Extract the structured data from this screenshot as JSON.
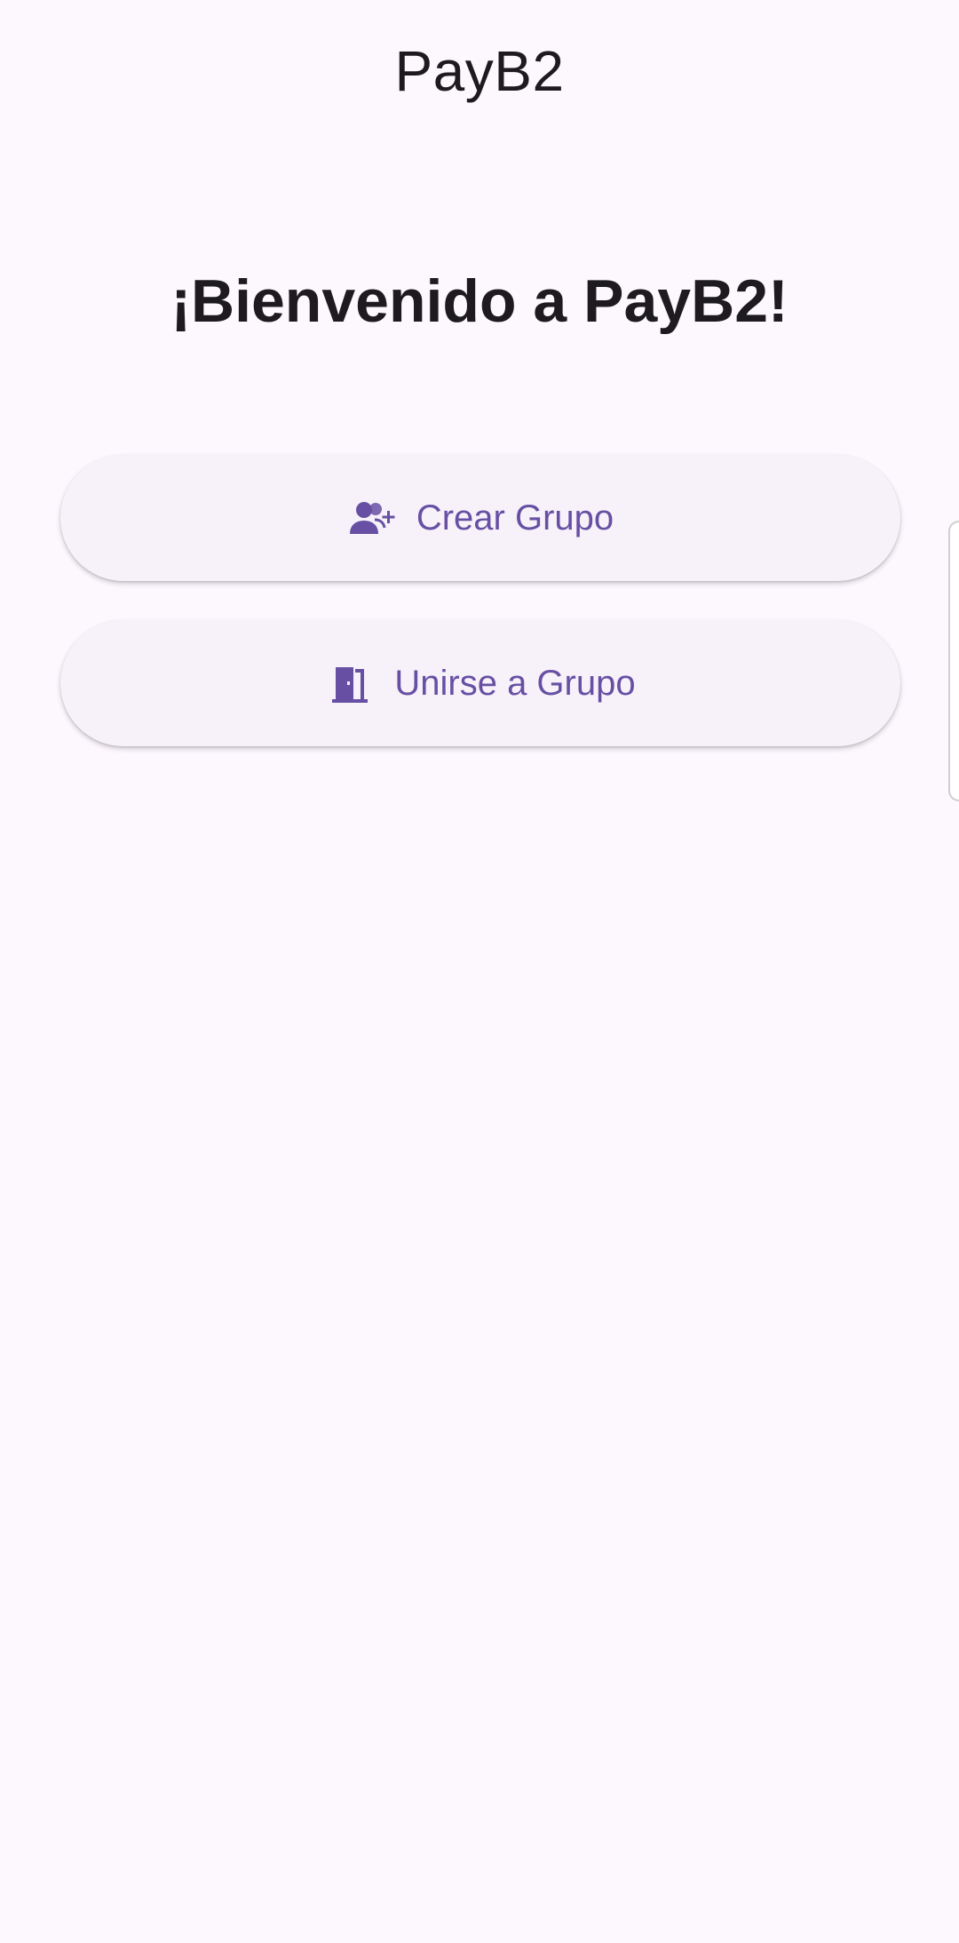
{
  "app_bar": {
    "title": "PayB2"
  },
  "main": {
    "welcome_text": "¡Bienvenido a PayB2!",
    "buttons": [
      {
        "label": "Crear Grupo",
        "icon": "group-add-icon"
      },
      {
        "label": "Unirse a Grupo",
        "icon": "door-enter-icon"
      }
    ]
  },
  "colors": {
    "background": "#fdf7fe",
    "button_background": "#f7f2f9",
    "accent": "#6750a4",
    "text": "#1d1b20"
  }
}
